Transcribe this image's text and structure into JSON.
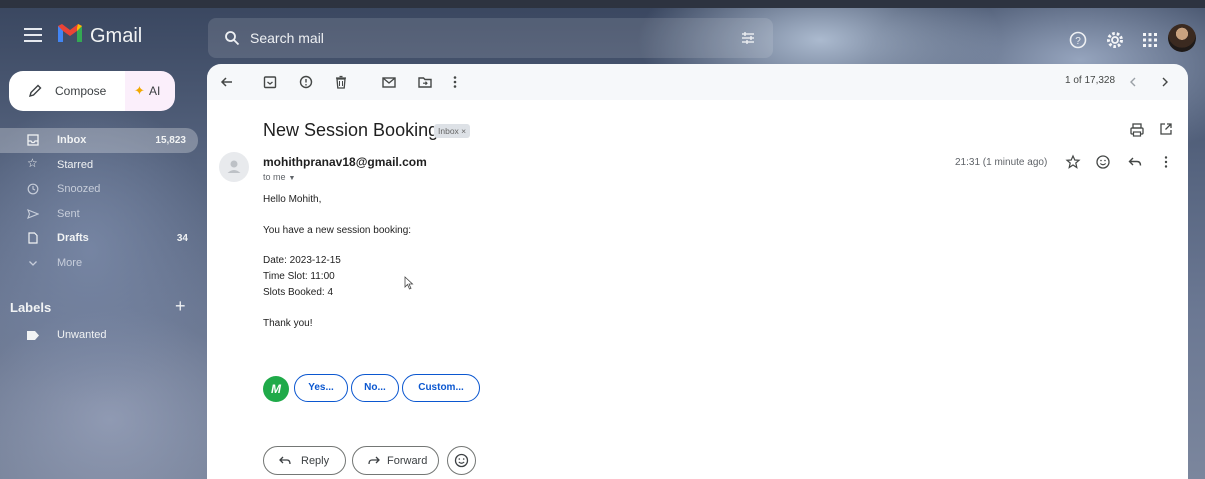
{
  "header": {
    "brand": "Gmail",
    "search_placeholder": "Search mail"
  },
  "sidebar": {
    "compose_label": "Compose",
    "ai_label": "AI",
    "items": [
      {
        "label": "Inbox",
        "count": "15,823",
        "icon": "inbox-icon"
      },
      {
        "label": "Starred",
        "count": "",
        "icon": "star-icon"
      },
      {
        "label": "Snoozed",
        "count": "",
        "icon": "clock-icon"
      },
      {
        "label": "Sent",
        "count": "",
        "icon": "send-icon"
      },
      {
        "label": "Drafts",
        "count": "34",
        "icon": "draft-icon"
      },
      {
        "label": "More",
        "count": "",
        "icon": "chevron-down-icon"
      }
    ],
    "labels_heading": "Labels",
    "labels": [
      {
        "label": "Unwanted"
      }
    ]
  },
  "toolbar": {
    "pager": "1 of 17,328"
  },
  "email": {
    "subject": "New Session Booking",
    "chip": "Inbox ×",
    "sender": "mohithpranav18@gmail.com",
    "to": "to me",
    "time": "21:31 (1 minute ago)",
    "body": [
      "Hello Mohith,",
      "You have a new session booking:",
      "Date: 2023-12-15",
      "Time Slot: 11:00",
      "Slots Booked: 4",
      "Thank you!"
    ]
  },
  "smart_replies": [
    "Yes...",
    "No...",
    "Custom..."
  ],
  "actions": {
    "reply": "Reply",
    "forward": "Forward"
  },
  "colors": {
    "accent_blue": "#0b57d0",
    "gmail_red": "#ea4335",
    "addon_green": "#1faa49"
  }
}
